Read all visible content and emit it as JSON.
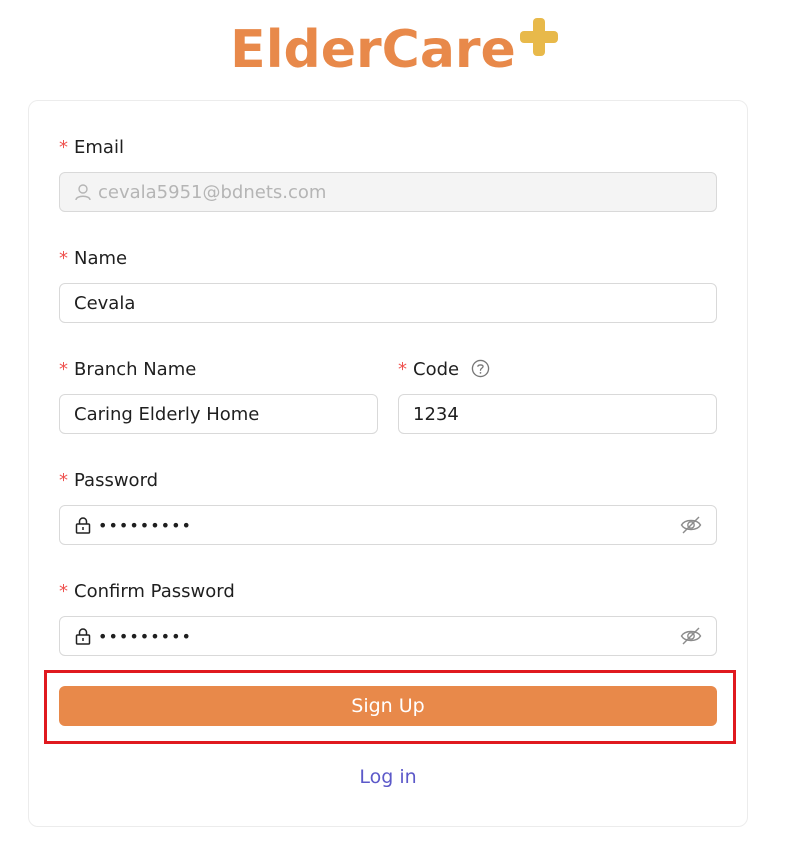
{
  "logo": {
    "text": "ElderCare",
    "plus_color": "#e8b94a",
    "text_color": "#e8894a"
  },
  "form": {
    "email": {
      "label": "Email",
      "value": "cevala5951@bdnets.com",
      "disabled": true,
      "icon": "user-icon"
    },
    "name": {
      "label": "Name",
      "value": "Cevala"
    },
    "branch_name": {
      "label": "Branch Name",
      "value": "Caring Elderly Home"
    },
    "code": {
      "label": "Code",
      "value": "1234",
      "help_icon": "question-circle-icon"
    },
    "password": {
      "label": "Password",
      "value": "•••••••••",
      "icon": "lock-icon",
      "toggle_icon": "eye-slash-icon"
    },
    "confirm_password": {
      "label": "Confirm Password",
      "value": "•••••••••",
      "icon": "lock-icon",
      "toggle_icon": "eye-slash-icon"
    },
    "required_marker": "*"
  },
  "actions": {
    "signup_label": "Sign Up",
    "login_label": "Log in"
  },
  "colors": {
    "accent": "#e8894a",
    "link": "#5c59c9",
    "highlight": "#e0191f",
    "required": "#ef5350"
  }
}
